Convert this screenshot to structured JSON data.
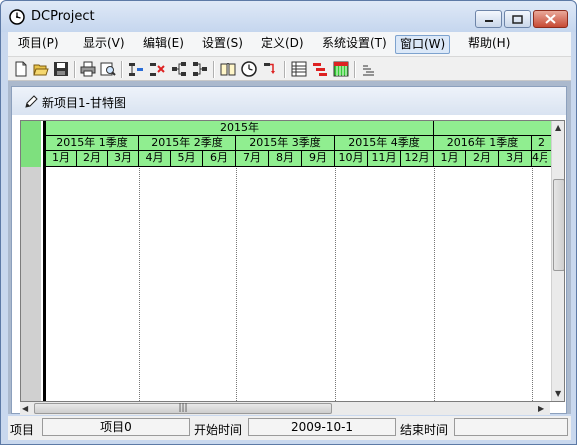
{
  "window": {
    "title": "DCProject"
  },
  "menu": [
    {
      "label": "项目(P)"
    },
    {
      "label": "显示(V)"
    },
    {
      "label": "编辑(E)"
    },
    {
      "label": "设置(S)"
    },
    {
      "label": "定义(D)"
    },
    {
      "label": "系统设置(T)"
    },
    {
      "label": "窗口(W)"
    },
    {
      "label": "帮助(H)"
    }
  ],
  "toolbar_icons": [
    "new-icon",
    "open-icon",
    "save-icon",
    "print-icon",
    "print-preview-icon",
    "insert-task-icon",
    "delete-task-icon",
    "link-task-icon",
    "unlink-task-icon",
    "calendar-icon",
    "clock-icon",
    "dependency-icon",
    "table-icon",
    "gantt-bars-icon",
    "resource-icon",
    "indent-icon"
  ],
  "child": {
    "title": "新项目1-甘特图"
  },
  "gantt": {
    "years": [
      {
        "label": "2015年"
      },
      {
        "label": ""
      }
    ],
    "quarters": [
      {
        "label": "2015年 1季度"
      },
      {
        "label": "2015年 2季度"
      },
      {
        "label": "2015年 3季度"
      },
      {
        "label": "2015年 4季度"
      },
      {
        "label": "2016年 1季度"
      },
      {
        "label": "2"
      }
    ],
    "months": [
      "1月",
      "2月",
      "3月",
      "4月",
      "5月",
      "6月",
      "7月",
      "8月",
      "9月",
      "10月",
      "11月",
      "12月",
      "1月",
      "2月",
      "3月",
      "4月"
    ]
  },
  "status": {
    "project_label": "项目",
    "project_value": "项目0",
    "start_label": "开始时间",
    "start_value": "2009-10-1",
    "end_label": "结束时间"
  },
  "colors": {
    "header_green": "#90ee90",
    "title_blue": "#c5d6ee"
  }
}
